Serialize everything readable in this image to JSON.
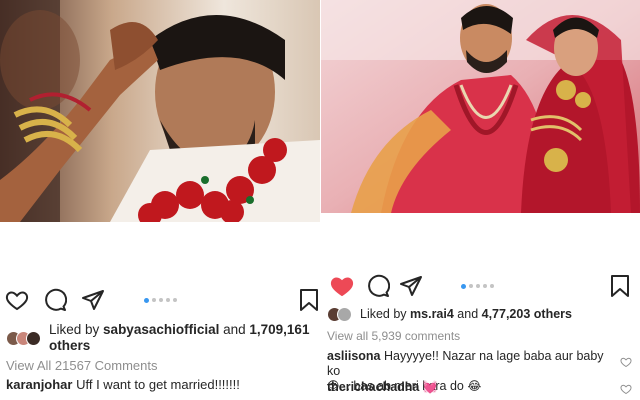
{
  "colors": {
    "like_red": "#ed4956",
    "dot_active": "#3897f0",
    "muted_text": "#8e8e8e",
    "text": "#262626"
  },
  "left_post": {
    "photo_alt_icon": "photo-groom-tilak",
    "carousel": {
      "count": 5,
      "active_index": 0
    },
    "liked": false,
    "likes": {
      "prefix": "Liked by ",
      "user": "sabyasachiofficial",
      "middle": " and ",
      "count": "1,709,161",
      "suffix": " others"
    },
    "view_all": "View All 21567 Comments",
    "comments": [
      {
        "user": "karanjohar",
        "text": " Uff I want to get married!!!!!!!"
      }
    ]
  },
  "right_post": {
    "photo_alt_icon": "photo-couple-wedding",
    "carousel": {
      "count": 5,
      "active_index": 0
    },
    "liked": true,
    "likes": {
      "prefix": "Liked by ",
      "user": "ms.rai4",
      "middle": " and ",
      "count": "4,77,203",
      "suffix": " others"
    },
    "view_all": "View all 5,939 comments",
    "comments": [
      {
        "user": "asliisona",
        "text_line1": " Hayyyye!! Nazar na lage baba aur baby ko",
        "emoji1": "😍",
        "text_line2": "... bas ab meri kara do ",
        "emoji2": "😂"
      },
      {
        "user": "therichachadha",
        "text": " ",
        "emoji": "💓"
      }
    ]
  },
  "icons": {
    "like": "heart-icon",
    "comment": "comment-icon",
    "share": "send-icon",
    "save": "bookmark-icon"
  }
}
